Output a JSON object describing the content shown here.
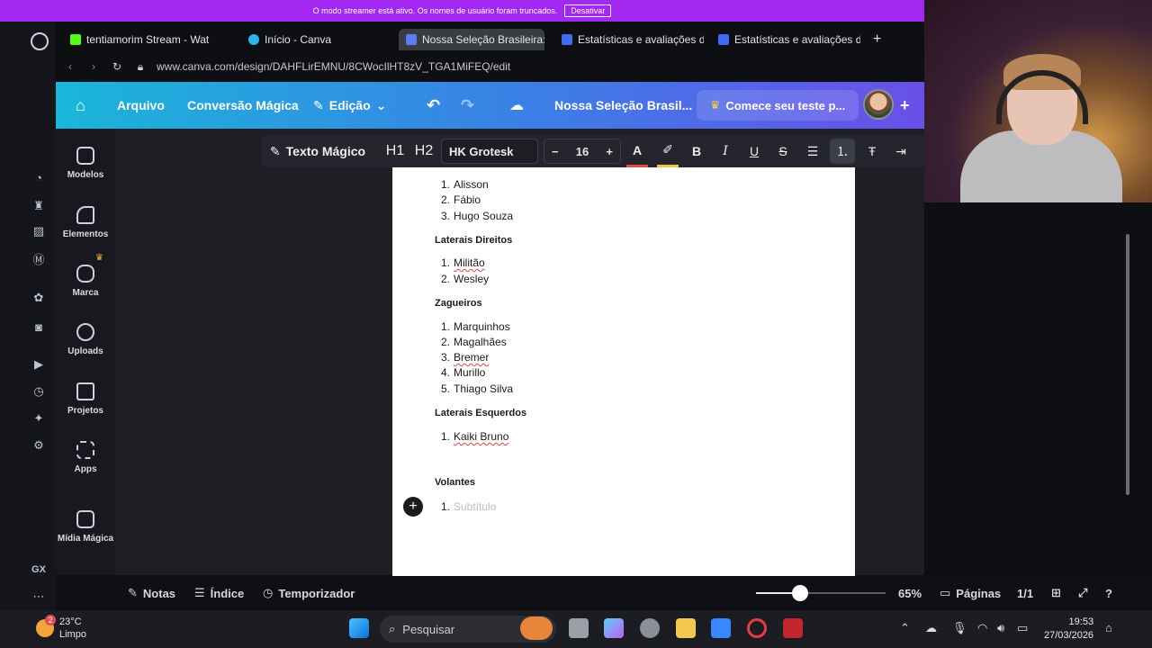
{
  "streamer": {
    "message": "O modo streamer está ativo. Os nomes de usuário foram truncados.",
    "button": "Desativar"
  },
  "tabs": [
    {
      "label": "tentiamorim Stream - Wat",
      "fav_color": "#53fc18"
    },
    {
      "label": "Início - Canva",
      "fav_color": "#2fb3e8"
    },
    {
      "label": "Nossa Seleção Brasileira:",
      "fav_color": "#5b7cf6"
    },
    {
      "label": "Estatísticas e avaliações d",
      "fav_color": "#3f6df2"
    },
    {
      "label": "Estatísticas e avaliações d",
      "fav_color": "#3f6df2"
    }
  ],
  "url": "www.canva.com/design/DAHFLirEMNU/8CWocIlHT8zV_TGA1MiFEQ/edit",
  "canva_header": {
    "file": "Arquivo",
    "magic": "Conversão Mágica",
    "edit": "Edição",
    "doc_title": "Nossa Seleção Brasil...",
    "trial": "Comece seu teste p..."
  },
  "rail": [
    "Modelos",
    "Elementos",
    "Marca",
    "Uploads",
    "Projetos",
    "Apps",
    "Mídia Mágica"
  ],
  "toolbar": {
    "magic_text": "Texto Mágico",
    "h1": "H1",
    "h2": "H2",
    "font": "HK Grotesk",
    "size": "16",
    "minus": "−",
    "plus": "+"
  },
  "doc": {
    "goalkeepers": [
      "Alisson",
      "Fábio",
      "Hugo Souza"
    ],
    "right_backs_title": "Laterais Direitos",
    "right_backs": [
      "Militão",
      "Wesley"
    ],
    "centre_backs_title": "Zagueiros",
    "centre_backs": [
      "Marquinhos",
      "Magalhães",
      "Bremer",
      "Murillo",
      "Thiago Silva"
    ],
    "left_backs_title": "Laterais Esquerdos",
    "left_backs": [
      "Kaiki Bruno"
    ],
    "volantes_title": "Volantes",
    "placeholder": "Subtítulo"
  },
  "footer": {
    "notes": "Notas",
    "index": "Índice",
    "timer": "Temporizador",
    "zoom": "65%",
    "pages": "Páginas",
    "page_count": "1/1",
    "zoom_level": 0.34
  },
  "opera_gx": "GX",
  "taskbar": {
    "temp": "23°C",
    "weather": "Limpo",
    "badge": "2",
    "search": "Pesquisar",
    "time": "19:53",
    "date": "27/03/2026"
  }
}
